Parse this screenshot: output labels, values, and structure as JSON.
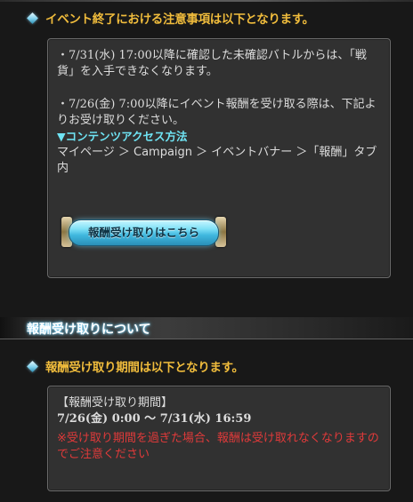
{
  "notice": {
    "heading": "イベント終了における注意事項は以下となります。",
    "para1": "・7/31(水) 17:00以降に確認した未確認バトルからは、「戦貨」を入手できなくなります。",
    "para2": "・7/26(金) 7:00以降にイベント報酬を受け取る際は、下記よりお受け取りください。",
    "access_title": "▼コンテンツアクセス方法",
    "access_path": "マイページ ＞ Campaign ＞ イベントバナー ＞「報酬」タブ内",
    "button_label": "報酬受け取りはこちら"
  },
  "reward_section": {
    "title": "報酬受け取りについて",
    "heading": "報酬受け取り期間は以下となります。",
    "period_label": "【報酬受け取り期間】",
    "period_value": "7/26(金) 0:00 ～ 7/31(水) 16:59",
    "warning": "※受け取り期間を過ぎた場合、報酬は受け取れなくなりますのでご注意ください"
  }
}
